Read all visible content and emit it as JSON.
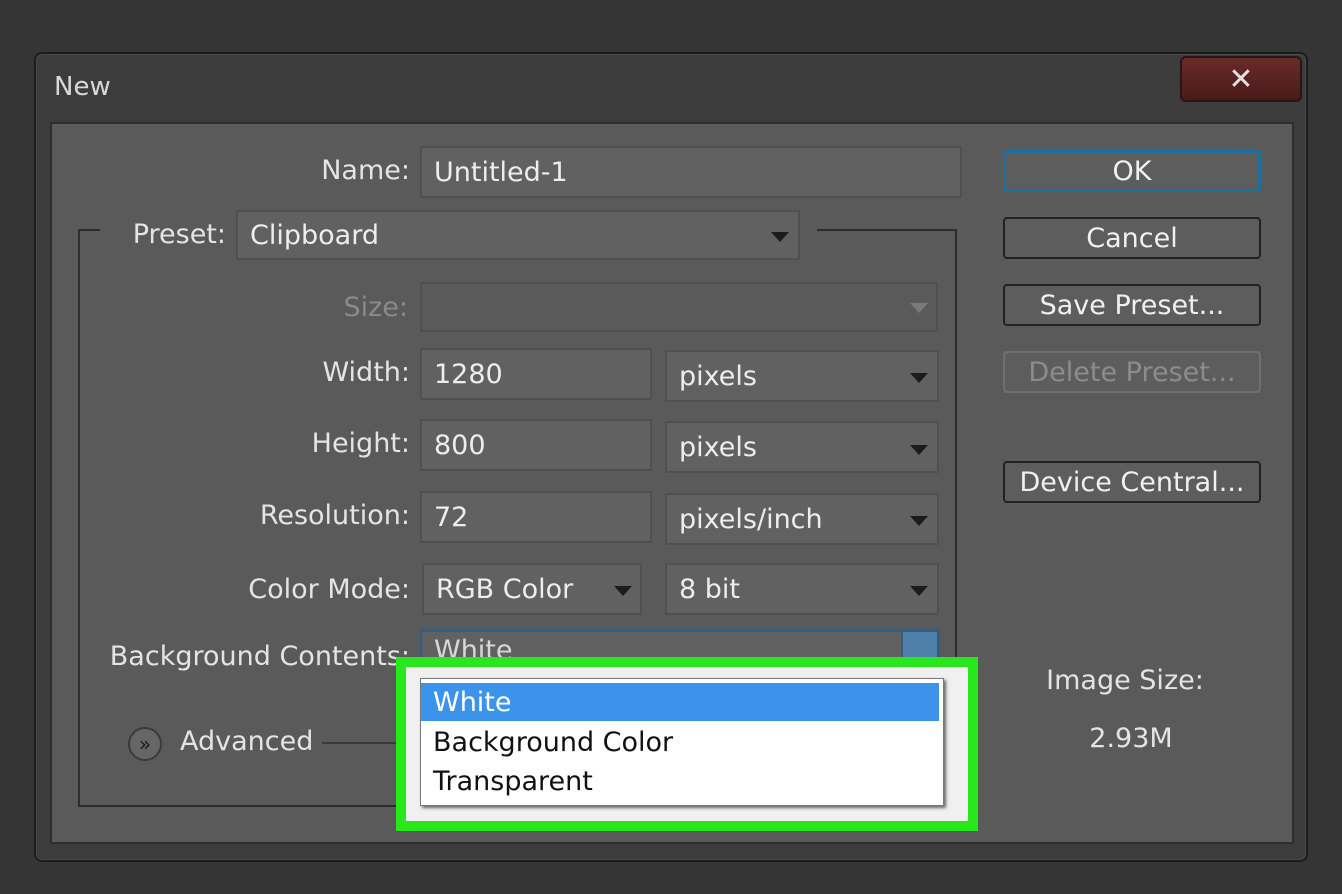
{
  "window": {
    "title": "New",
    "close_label": "✕"
  },
  "form": {
    "name_label": "Name:",
    "name_value": "Untitled-1",
    "preset_label": "Preset:",
    "preset_value": "Clipboard",
    "size_label": "Size:",
    "size_value": "",
    "width_label": "Width:",
    "width_value": "1280",
    "width_unit": "pixels",
    "height_label": "Height:",
    "height_value": "800",
    "height_unit": "pixels",
    "resolution_label": "Resolution:",
    "resolution_value": "72",
    "resolution_unit": "pixels/inch",
    "color_mode_label": "Color Mode:",
    "color_mode_value": "RGB Color",
    "bit_depth_value": "8 bit",
    "background_label": "Background Contents:",
    "background_value": "White",
    "advanced_label": "Advanced"
  },
  "dropdown": {
    "options": [
      "White",
      "Background Color",
      "Transparent"
    ]
  },
  "buttons": {
    "ok": "OK",
    "cancel": "Cancel",
    "save_preset": "Save Preset...",
    "delete_preset": "Delete Preset...",
    "device_central": "Device Central..."
  },
  "image_size": {
    "label": "Image Size:",
    "value": "2.93M"
  },
  "colors": {
    "highlight": "#28e81d",
    "selected_option": "#3c94ea",
    "ok_border": "#1d6fa0"
  }
}
